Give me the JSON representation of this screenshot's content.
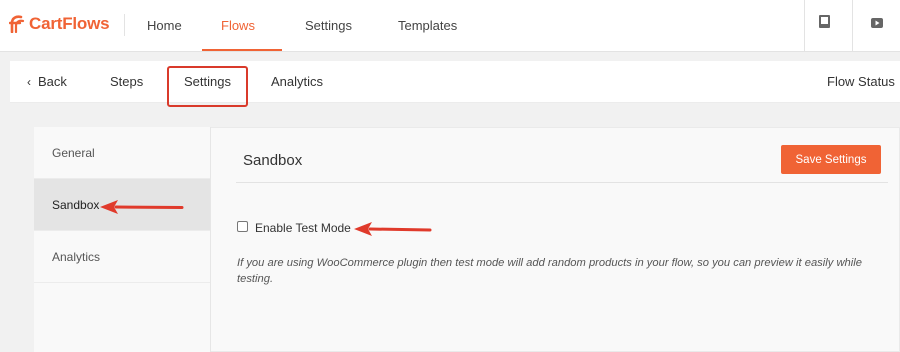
{
  "header": {
    "logo_text": "CartFlows",
    "nav": [
      {
        "label": "Home"
      },
      {
        "label": "Flows"
      },
      {
        "label": "Settings"
      },
      {
        "label": "Templates"
      }
    ],
    "right_icons": [
      "book-icon",
      "video-icon"
    ]
  },
  "subnav": {
    "back_label": "Back",
    "items": [
      {
        "label": "Steps"
      },
      {
        "label": "Settings"
      },
      {
        "label": "Analytics"
      }
    ],
    "flow_status_label": "Flow Status"
  },
  "sidebar": {
    "items": [
      {
        "label": "General"
      },
      {
        "label": "Sandbox"
      },
      {
        "label": "Analytics"
      }
    ]
  },
  "content": {
    "title": "Sandbox",
    "save_label": "Save Settings",
    "checkbox_label": "Enable Test Mode",
    "description": "If you are using WooCommerce plugin then test mode will add random products in your flow, so you can preview it easily while testing."
  },
  "colors": {
    "accent": "#f06335",
    "annotation_red": "#e03a2b"
  }
}
